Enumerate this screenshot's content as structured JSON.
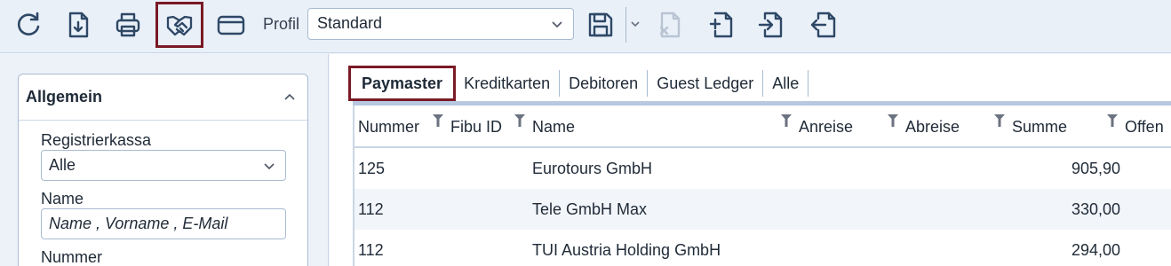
{
  "toolbar": {
    "profil_label": "Profil",
    "profil_value": "Standard",
    "buttons": [
      "refresh-icon",
      "download-document-icon",
      "print-icon",
      "handshake-icon",
      "credit-card-icon",
      "save-icon",
      "delete-document-icon",
      "add-document-icon",
      "import-document-icon",
      "export-document-icon"
    ]
  },
  "sidebar": {
    "card_title": "Allgemein",
    "registrierkasse_label": "Registrierkassa",
    "registrierkasse_value": "Alle",
    "name_label": "Name",
    "name_placeholder": "Name , Vorname , E-Mail",
    "nummer_label": "Nummer"
  },
  "tabs": [
    {
      "label": "Paymaster",
      "active": true
    },
    {
      "label": "Kreditkarten",
      "active": false
    },
    {
      "label": "Debitoren",
      "active": false
    },
    {
      "label": "Guest Ledger",
      "active": false
    },
    {
      "label": "Alle",
      "active": false
    }
  ],
  "table": {
    "columns": [
      "Nummer",
      "Fibu ID",
      "Name",
      "Anreise",
      "Abreise",
      "Summe",
      "Offen"
    ],
    "rows": [
      {
        "nummer": "125",
        "fibu": "",
        "name": "Eurotours GmbH",
        "anreise": "",
        "abreise": "",
        "summe": "905,90",
        "offen": ""
      },
      {
        "nummer": "112",
        "fibu": "",
        "name": "Tele GmbH Max",
        "anreise": "",
        "abreise": "",
        "summe": "330,00",
        "offen": ""
      },
      {
        "nummer": "112",
        "fibu": "",
        "name": "TUI Austria Holding GmbH",
        "anreise": "",
        "abreise": "",
        "summe": "294,00",
        "offen": ""
      }
    ]
  },
  "colors": {
    "accent_outline": "#7a1a25",
    "icon_stroke": "#2e4866",
    "icon_disabled": "#b9c4d3"
  }
}
